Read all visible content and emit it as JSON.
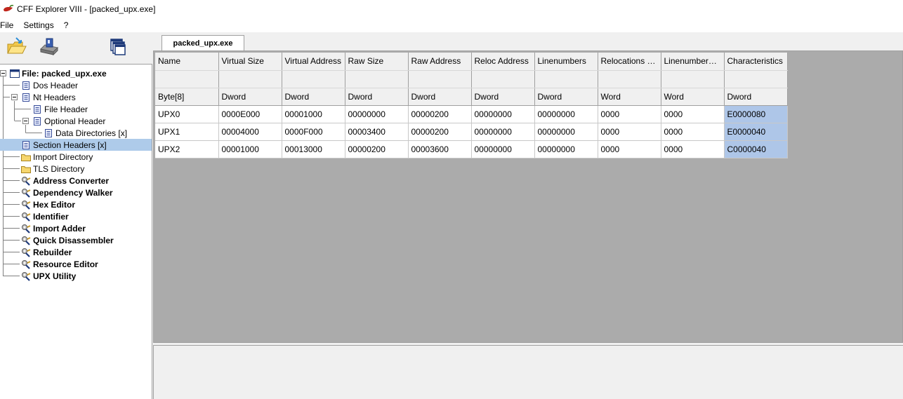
{
  "window": {
    "title": "CFF Explorer VIII - [packed_upx.exe]"
  },
  "menu": [
    "File",
    "Settings",
    "?"
  ],
  "toolbar": {
    "icons": [
      "open-folder-icon",
      "save-disk-icon",
      "windows-cascade-icon"
    ]
  },
  "tree": {
    "items": [
      {
        "label": "File: packed_upx.exe",
        "icon": "window-icon",
        "bold": true
      },
      {
        "label": "Dos Header",
        "icon": "struct-icon"
      },
      {
        "label": "Nt Headers",
        "icon": "struct-icon"
      },
      {
        "label": "File Header",
        "icon": "struct-icon"
      },
      {
        "label": "Optional Header",
        "icon": "struct-icon"
      },
      {
        "label": "Data Directories [x]",
        "icon": "struct-icon"
      },
      {
        "label": "Section Headers [x]",
        "icon": "struct-icon",
        "selected": true
      },
      {
        "label": "Import Directory",
        "icon": "folder-icon"
      },
      {
        "label": "TLS Directory",
        "icon": "folder-icon"
      },
      {
        "label": "Address Converter",
        "icon": "tool-icon",
        "bold": true
      },
      {
        "label": "Dependency Walker",
        "icon": "tool-icon",
        "bold": true
      },
      {
        "label": "Hex Editor",
        "icon": "tool-icon",
        "bold": true
      },
      {
        "label": "Identifier",
        "icon": "tool-icon",
        "bold": true
      },
      {
        "label": "Import Adder",
        "icon": "tool-icon",
        "bold": true
      },
      {
        "label": "Quick Disassembler",
        "icon": "tool-icon",
        "bold": true
      },
      {
        "label": "Rebuilder",
        "icon": "tool-icon",
        "bold": true
      },
      {
        "label": "Resource Editor",
        "icon": "tool-icon",
        "bold": true
      },
      {
        "label": "UPX Utility",
        "icon": "tool-icon",
        "bold": true
      }
    ]
  },
  "tabs": [
    {
      "label": "packed_upx.exe",
      "active": true
    }
  ],
  "grid": {
    "columns": [
      "Name",
      "Virtual Size",
      "Virtual Address",
      "Raw Size",
      "Raw Address",
      "Reloc Address",
      "Linenumbers",
      "Relocations N...",
      "Linenumbers ...",
      "Characteristics"
    ],
    "types": [
      "Byte[8]",
      "Dword",
      "Dword",
      "Dword",
      "Dword",
      "Dword",
      "Dword",
      "Word",
      "Word",
      "Dword"
    ],
    "rows": [
      [
        "UPX0",
        "0000E000",
        "00001000",
        "00000000",
        "00000200",
        "00000000",
        "00000000",
        "0000",
        "0000",
        "E0000080"
      ],
      [
        "UPX1",
        "00004000",
        "0000F000",
        "00003400",
        "00000200",
        "00000000",
        "00000000",
        "0000",
        "0000",
        "E0000040"
      ],
      [
        "UPX2",
        "00001000",
        "00013000",
        "00000200",
        "00003600",
        "00000000",
        "00000000",
        "0000",
        "0000",
        "C0000040"
      ]
    ]
  },
  "colors": {
    "selection": "#aecbea",
    "highlight_column": "#aec6e8",
    "grid_background": "#ababab"
  }
}
